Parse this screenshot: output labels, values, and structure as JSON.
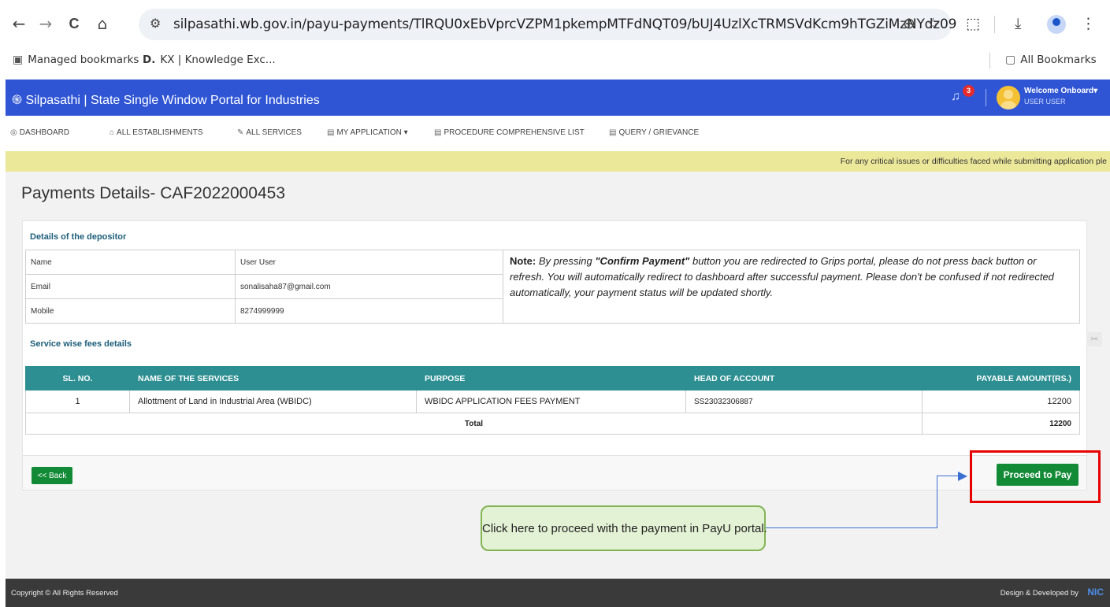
{
  "browser": {
    "url": "silpasathi.wb.gov.in/payu-payments/TlRQU0xEbVprcVZPM1pkempMTFdNQT09/bUJ4UzlXcTRMSVdKcm9hTGZiMzNYdz09",
    "icons": {
      "back": "←",
      "forward": "→",
      "reload": "C",
      "home": "⌂",
      "site_info": "⚙",
      "zoom": "⊕",
      "star": "☆",
      "extensions": "⬚",
      "download": "⤓",
      "menu": "⋮"
    },
    "bookmarks": {
      "managed": "Managed bookmarks",
      "kx_prefix": "D.",
      "kx": "KX | Knowledge Exc...",
      "all": "All Bookmarks"
    }
  },
  "header": {
    "title": "Silpasathi | State Single Window Portal for Industries",
    "logo_glyph": "֍",
    "bell_glyph": "♫",
    "notification_count": "3",
    "welcome": "Welcome Onboard",
    "welcome_caret": "▾",
    "user": "USER USER"
  },
  "menu": [
    {
      "icon": "◎",
      "label": "Dashboard"
    },
    {
      "icon": "⌂",
      "label": "All Establishments"
    },
    {
      "icon": "✎",
      "label": "All Services"
    },
    {
      "icon": "▤",
      "label": "My Application",
      "caret": "▾"
    },
    {
      "icon": "▤",
      "label": "Procedure Comprehensive List"
    },
    {
      "icon": "▤",
      "label": "Query / Grievance"
    }
  ],
  "notice": "For any critical issues or difficulties faced while submitting application ple",
  "page": {
    "title": "Payments Details- CAF2022000453",
    "depositor": {
      "heading": "Details of the depositor",
      "rows": [
        {
          "label": "Name",
          "value": "User User"
        },
        {
          "label": "Email",
          "value": "sonalisaha87@gmail.com"
        },
        {
          "label": "Mobile",
          "value": "8274999999"
        }
      ],
      "note_label": "Note:",
      "note_pre": "By pressing ",
      "note_button": "\"Confirm Payment\"",
      "note_post": " button you are redirected to Grips portal, please do not press back button or refresh. You will automatically redirect to dashboard after successful payment. Please don't be confused if not redirected automatically, your payment status will be updated shortly."
    },
    "fees": {
      "heading": "Service wise fees details",
      "columns": [
        "Sl. No.",
        "Name of the Services",
        "Purpose",
        "Head of Account",
        "Payable Amount(Rs.)"
      ],
      "rows": [
        {
          "sl": "1",
          "service": "Allottment of Land in Industrial Area  (WBIDC)",
          "purpose": "WBIDC APPLICATION FEES PAYMENT",
          "head": "SS23032306887",
          "amount": "12200"
        }
      ],
      "total_label": "Total",
      "total_amount": "12200"
    },
    "back_label": "<< Back",
    "pay_label": "Proceed to Pay"
  },
  "callout": "Click here to proceed with the payment in PayU portal.",
  "footer": {
    "copyright": "Copyright © All Rights Reserved",
    "design": "Design & Developed by",
    "nic": "NIC"
  },
  "side_tab": "><",
  "colors": {
    "header_blue": "#2f55d4",
    "table_header_teal": "#2d8f92",
    "button_green": "#138a36",
    "highlight_red": "#e60000",
    "callout_green": "#e3f1d4"
  }
}
